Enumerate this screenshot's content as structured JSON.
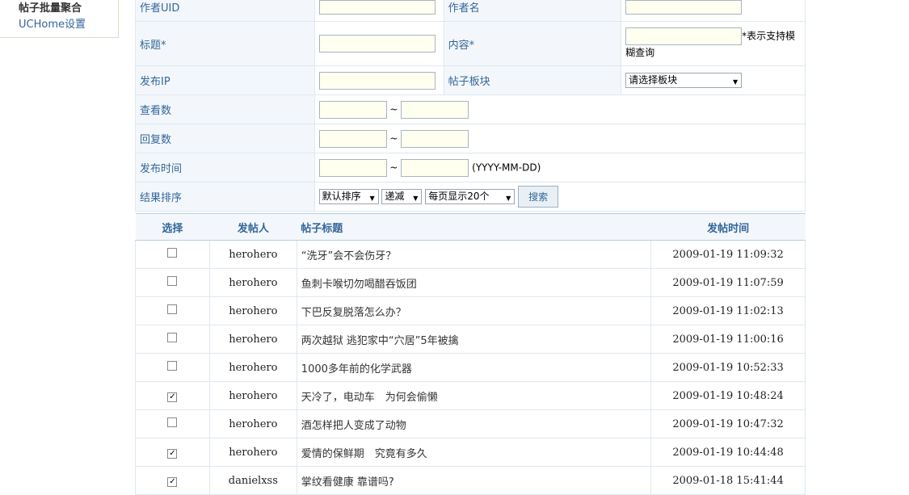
{
  "sidebar": {
    "active": "帖子批量聚合",
    "link": "UCHome设置"
  },
  "form": {
    "author_uid": "作者UID",
    "author_name": "作者名",
    "title": "标题*",
    "content": "内容*",
    "fuzzy_note": "*表示支持模糊查询",
    "ip": "发布IP",
    "board": "帖子板块",
    "board_select": "请选择板块",
    "views": "查看数",
    "replies": "回复数",
    "pubtime": "发布时间",
    "tilde": "~",
    "date_format": "(YYYY-MM-DD)",
    "sort": "结果排序",
    "sort_select": "默认排序",
    "order_select": "递减",
    "perpage_select": "每页显示20个",
    "search_btn": "搜索"
  },
  "table": {
    "headers": {
      "select": "选择",
      "author": "发帖人",
      "title": "帖子标题",
      "time": "发帖时间"
    },
    "rows": [
      {
        "author": "herohero",
        "title": "“洗牙”会不会伤牙？",
        "time": "2009-01-19 11:09:32",
        "check": ""
      },
      {
        "author": "herohero",
        "title": "鱼刺卡喉切勿喝醋吞饭团",
        "time": "2009-01-19 11:07:59",
        "check": ""
      },
      {
        "author": "herohero",
        "title": "下巴反复脱落怎么办？",
        "time": "2009-01-19 11:02:13",
        "check": ""
      },
      {
        "author": "herohero",
        "title": "两次越狱 逃犯家中“穴居”5年被擒",
        "time": "2009-01-19 11:00:16",
        "check": ""
      },
      {
        "author": "herohero",
        "title": "1000多年前的化学武器",
        "time": "2009-01-19 10:52:33",
        "check": ""
      },
      {
        "author": "herohero",
        "title": "天冷了，电动车　为何会偷懒",
        "time": "2009-01-19 10:48:24",
        "check": "✓"
      },
      {
        "author": "herohero",
        "title": "酒怎样把人变成了动物",
        "time": "2009-01-19 10:47:32",
        "check": ""
      },
      {
        "author": "herohero",
        "title": "爱情的保鲜期　究竟有多久",
        "time": "2009-01-19 10:44:48",
        "check": "✓"
      },
      {
        "author": "danielxss",
        "title": "掌纹看健康 靠谱吗?",
        "time": "2009-01-18 15:41:44",
        "check": "✓"
      }
    ]
  }
}
